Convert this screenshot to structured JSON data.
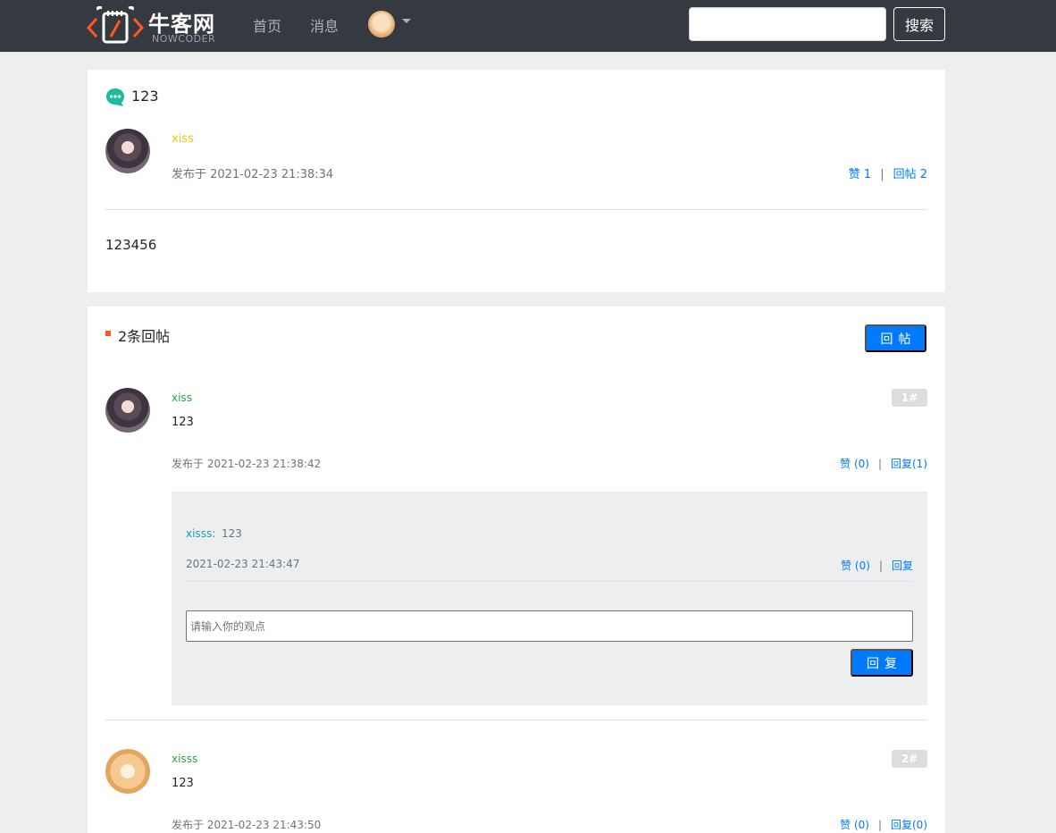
{
  "navbar": {
    "logo_cn": "牛客网",
    "logo_en": "NOWCODER",
    "links": {
      "home": "首页",
      "messages": "消息"
    },
    "search": {
      "value": "",
      "placeholder": ""
    },
    "search_button": "搜索"
  },
  "post": {
    "title": "123",
    "author": "xiss",
    "time": "发布于 2021-02-23 21:38:34",
    "like_label": "赞 1",
    "reply_label": "回帖 2",
    "separator": "|",
    "content": "123456"
  },
  "replies_section": {
    "title": "2条回帖",
    "reply_button": "回帖",
    "replies": [
      {
        "author": "xiss",
        "content": "123",
        "time": "发布于 2021-02-23 21:38:42",
        "floor": "1#",
        "like_label": "赞 (0)",
        "reply_label": "回复(1)",
        "separator": "|",
        "sub_replies": [
          {
            "author": "xisss",
            "colon": ":",
            "content": "123",
            "time": "2021-02-23 21:43:47",
            "like_label": "赞 (0)",
            "reply_label": "回复",
            "separator": "|"
          }
        ],
        "reply_input": {
          "value": "",
          "placeholder": "请输入你的观点"
        },
        "reply_button": "回复"
      },
      {
        "author": "xisss",
        "content": "123",
        "time": "发布于 2021-02-23 21:43:50",
        "floor": "2#",
        "like_label": "赞 (0)",
        "reply_label": "回复(0)",
        "separator": "|"
      }
    ]
  },
  "colors": {
    "navbar_bg": "#343a40",
    "primary": "#007bff",
    "author_yellow": "#ffc107",
    "author_green": "#28a745",
    "sub_author_teal": "#17a2b8",
    "section_mark": "#ff5722",
    "page_bg": "#eeeeee"
  },
  "icons": {
    "logo": "nowcoder-logo-icon",
    "post_title": "chat-bubble-icon",
    "dropdown": "caret-down-icon"
  }
}
